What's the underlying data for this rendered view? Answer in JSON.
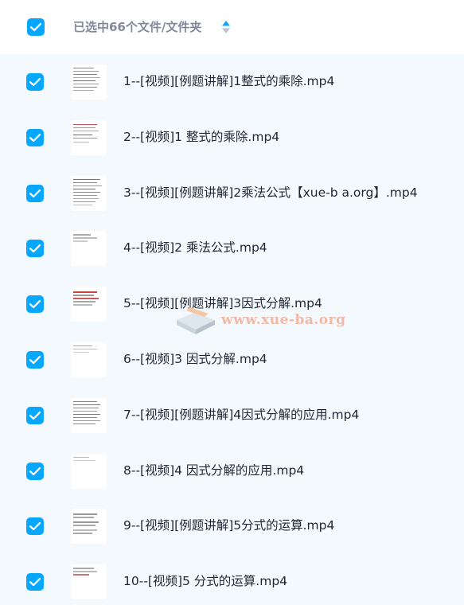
{
  "header": {
    "selected_text": "已选中66个文件/文件夹",
    "select_all_checked": true,
    "sort_icon": "sort-arrows-icon"
  },
  "colors": {
    "accent": "#06a7ff",
    "list_bg": "#f4f9fd",
    "header_bg": "#ffffff",
    "text": "#1d2733",
    "muted": "#818999"
  },
  "files": [
    {
      "name": "1--[视频][例题讲解]1整式的乘除.mp4",
      "checked": true
    },
    {
      "name": "2--[视频]1 整式的乘除.mp4",
      "checked": true
    },
    {
      "name": "3--[视频][例题讲解]2乘法公式【xue-b a.org】.mp4",
      "checked": true
    },
    {
      "name": "4--[视频]2 乘法公式.mp4",
      "checked": true
    },
    {
      "name": "5--[视频][例题讲解]3因式分解.mp4",
      "checked": true
    },
    {
      "name": "6--[视频]3 因式分解.mp4",
      "checked": true
    },
    {
      "name": "7--[视频][例题讲解]4因式分解的应用.mp4",
      "checked": true
    },
    {
      "name": "8--[视频]4 因式分解的应用.mp4",
      "checked": true
    },
    {
      "name": "9--[视频][例题讲解]5分式的运算.mp4",
      "checked": true
    },
    {
      "name": "10--[视频]5 分式的运算.mp4",
      "checked": true
    }
  ],
  "watermark": {
    "text": "www.xue-ba.org"
  }
}
